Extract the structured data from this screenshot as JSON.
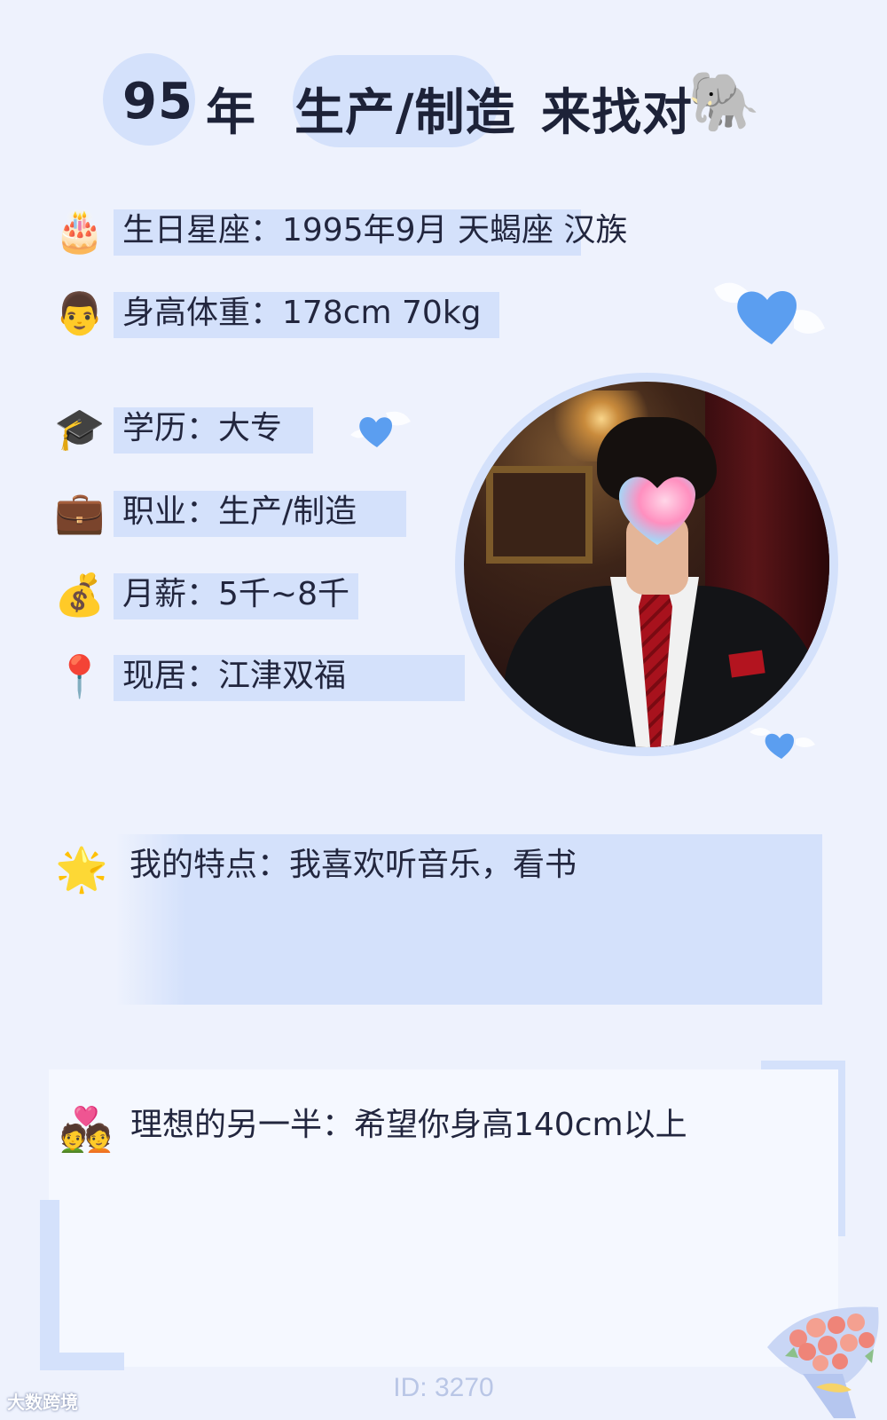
{
  "header": {
    "year": "95",
    "year_suffix": "年",
    "occupation": "生产/制造",
    "tagline": "来找对",
    "tagline_emoji": "🐘"
  },
  "info_rows": [
    {
      "icon": "🎂",
      "icon_name": "birthday-cake-icon",
      "text": "生日星座：1995年9月 天蝎座 汉族"
    },
    {
      "icon": "👨",
      "icon_name": "man-face-icon",
      "text": "身高体重：178cm 70kg"
    },
    {
      "icon": "🎓",
      "icon_name": "graduation-cap-icon",
      "text": "学历：大专"
    },
    {
      "icon": "💼",
      "icon_name": "briefcase-icon",
      "text": "职业：生产/制造"
    },
    {
      "icon": "💰",
      "icon_name": "money-bag-icon",
      "text": "月薪：5千~8千"
    },
    {
      "icon": "📍",
      "icon_name": "location-pin-icon",
      "text": "现居：江津双福"
    }
  ],
  "features": {
    "icon": "🌟",
    "text": "我的特点：我喜欢听音乐，看书"
  },
  "ideal_partner": {
    "icon": "💑",
    "text": "理想的另一半：希望你身高140cm以上"
  },
  "footer": {
    "id_label": "ID: 3270",
    "watermark": "大数跨境"
  },
  "colors": {
    "background": "#eef2fd",
    "highlight": "#d4e1fb",
    "heart": "#5b9ef0",
    "text": "#22263e"
  }
}
